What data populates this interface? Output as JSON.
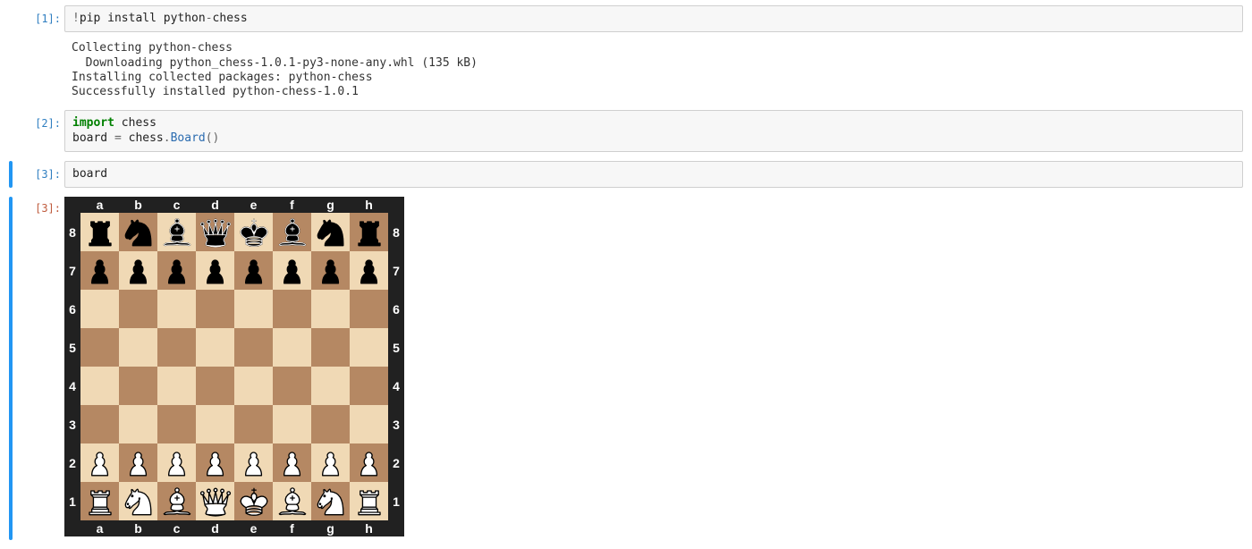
{
  "cells": [
    {
      "prompt_in": "[1]:",
      "code_html": "<span class='c-op'>!</span><span class='c-plain'>pip install python</span><span class='c-op'>-</span><span class='c-plain'>chess</span>",
      "output_text": "Collecting python-chess\n  Downloading python_chess-1.0.1-py3-none-any.whl (135 kB)\nInstalling collected packages: python-chess\nSuccessfully installed python-chess-1.0.1",
      "selected": false
    },
    {
      "prompt_in": "[2]:",
      "code_html": "<span class='c-kw'>import</span> <span class='c-plain'>chess</span>\n<span class='c-plain'>board</span> <span class='c-op'>=</span> <span class='c-plain'>chess</span><span class='c-op'>.</span><span class='c-builtin'>Board</span><span class='c-op'>()</span>",
      "selected": false
    },
    {
      "prompt_in": "[3]:",
      "code_html": "<span class='c-plain'>board</span>",
      "selected": true
    }
  ],
  "output_prompt": "[3]:",
  "chess": {
    "files": [
      "a",
      "b",
      "c",
      "d",
      "e",
      "f",
      "g",
      "h"
    ],
    "ranks": [
      "8",
      "7",
      "6",
      "5",
      "4",
      "3",
      "2",
      "1"
    ],
    "light_square": "#f0d9b5",
    "dark_square": "#b58863",
    "position_fen": "rnbqkbnr/pppppppp/8/8/8/8/PPPPPPPP/RNBQKBNR",
    "rows": [
      [
        {
          "p": "r",
          "c": "b"
        },
        {
          "p": "n",
          "c": "b"
        },
        {
          "p": "b",
          "c": "b"
        },
        {
          "p": "q",
          "c": "b"
        },
        {
          "p": "k",
          "c": "b"
        },
        {
          "p": "b",
          "c": "b"
        },
        {
          "p": "n",
          "c": "b"
        },
        {
          "p": "r",
          "c": "b"
        }
      ],
      [
        {
          "p": "p",
          "c": "b"
        },
        {
          "p": "p",
          "c": "b"
        },
        {
          "p": "p",
          "c": "b"
        },
        {
          "p": "p",
          "c": "b"
        },
        {
          "p": "p",
          "c": "b"
        },
        {
          "p": "p",
          "c": "b"
        },
        {
          "p": "p",
          "c": "b"
        },
        {
          "p": "p",
          "c": "b"
        }
      ],
      [
        null,
        null,
        null,
        null,
        null,
        null,
        null,
        null
      ],
      [
        null,
        null,
        null,
        null,
        null,
        null,
        null,
        null
      ],
      [
        null,
        null,
        null,
        null,
        null,
        null,
        null,
        null
      ],
      [
        null,
        null,
        null,
        null,
        null,
        null,
        null,
        null
      ],
      [
        {
          "p": "p",
          "c": "w"
        },
        {
          "p": "p",
          "c": "w"
        },
        {
          "p": "p",
          "c": "w"
        },
        {
          "p": "p",
          "c": "w"
        },
        {
          "p": "p",
          "c": "w"
        },
        {
          "p": "p",
          "c": "w"
        },
        {
          "p": "p",
          "c": "w"
        },
        {
          "p": "p",
          "c": "w"
        }
      ],
      [
        {
          "p": "r",
          "c": "w"
        },
        {
          "p": "n",
          "c": "w"
        },
        {
          "p": "b",
          "c": "w"
        },
        {
          "p": "q",
          "c": "w"
        },
        {
          "p": "k",
          "c": "w"
        },
        {
          "p": "b",
          "c": "w"
        },
        {
          "p": "n",
          "c": "w"
        },
        {
          "p": "r",
          "c": "w"
        }
      ]
    ]
  }
}
